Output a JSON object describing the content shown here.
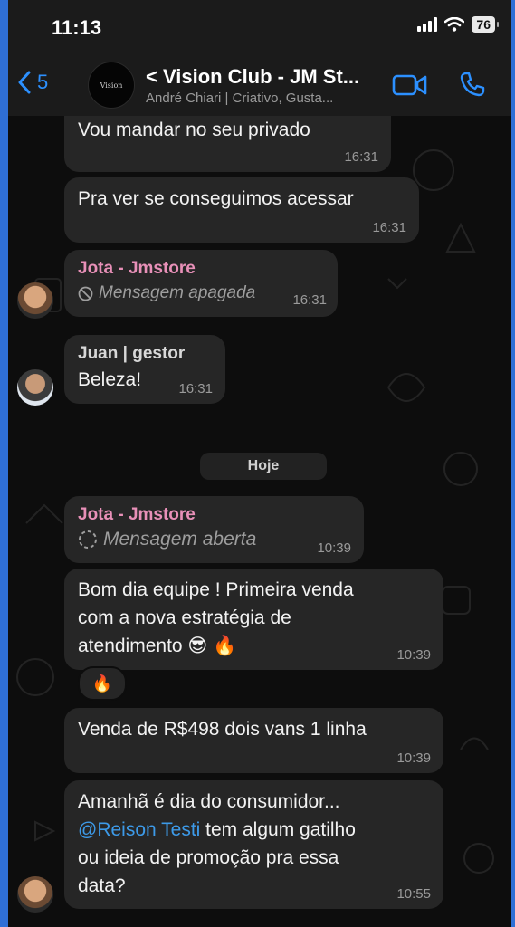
{
  "status_bar": {
    "time": "11:13",
    "battery": "76"
  },
  "header": {
    "back_count": "5",
    "title": "< Vision Club - JM St...",
    "subtitle": "André Chiari | Criativo, Gusta...",
    "avatar_text": "Vision"
  },
  "messages": [
    {
      "text": "Vou mandar no seu privado",
      "time": "16:31"
    },
    {
      "text": "Pra ver se conseguimos acessar",
      "time": "16:31"
    },
    {
      "sender": "Jota - Jmstore",
      "text": "Mensagem apagada",
      "time": "16:31"
    },
    {
      "sender": "Juan | gestor",
      "text": "Beleza!",
      "time": "16:31"
    },
    {
      "sender": "Jota - Jmstore",
      "text": "Mensagem aberta",
      "time": "10:39"
    },
    {
      "text": "Bom dia equipe ! Primeira venda\ncom a nova estratégia de\natendimento 😎 🔥",
      "time": "10:39",
      "reaction": "🔥"
    },
    {
      "text": "Venda de R$498 dois vans 1 linha",
      "time": "10:39"
    },
    {
      "text_before": "Amanhã é dia do consumidor...",
      "mention": "@Reison Testi",
      "text_after": " tem algum gatilho\nou ideia de promoção pra essa\ndata?",
      "time": "10:55"
    }
  ],
  "date_separator": "Hoje",
  "colors": {
    "accent": "#2c90ff",
    "sender_pink": "#e890b8",
    "mention": "#3d9ae8",
    "bubble": "#262626"
  },
  "icons": [
    "back-chevron-icon",
    "video-camera-icon",
    "phone-icon",
    "blocked-icon",
    "open-circle-icon",
    "signal-icon",
    "wifi-icon"
  ]
}
